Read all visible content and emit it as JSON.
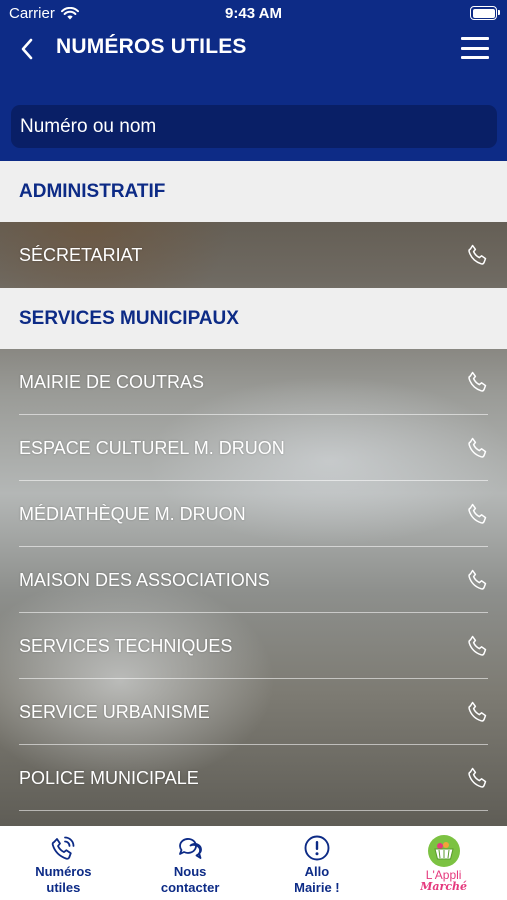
{
  "status_bar": {
    "carrier": "Carrier",
    "time": "9:43 AM"
  },
  "navbar": {
    "title": "NUMÉROS UTILES"
  },
  "search": {
    "placeholder": "Numéro ou nom"
  },
  "sections": [
    {
      "title": "ADMINISTRATIF",
      "items": [
        "SÉCRETARIAT"
      ]
    },
    {
      "title": "SERVICES MUNICIPAUX",
      "items": [
        "MAIRIE DE COUTRAS",
        "ESPACE CULTUREL M. DRUON",
        "MÉDIATHÈQUE M. DRUON",
        "MAISON DES ASSOCIATIONS",
        "SERVICES TECHNIQUES",
        "SERVICE URBANISME",
        "POLICE MUNICIPALE"
      ]
    }
  ],
  "tabbar": {
    "numeros": {
      "line1": "Numéros",
      "line2": "utiles"
    },
    "contact": {
      "line1": "Nous",
      "line2": "contacter"
    },
    "allo": {
      "line1": "Allo",
      "line2": "Mairie !"
    },
    "appli": {
      "line1": "L'Appli",
      "line2": "Marché"
    }
  },
  "colors": {
    "brand_blue": "#0d2b86",
    "search_bg": "#091f66",
    "section_bg": "#efefef",
    "logo_green": "#7cc242",
    "logo_pink": "#e5397d"
  },
  "icons": [
    "wifi-icon",
    "battery-icon",
    "back-chevron-icon",
    "hamburger-menu-icon",
    "phone-icon",
    "phone-waves-icon",
    "chat-bubbles-icon",
    "exclamation-circle-icon",
    "basket-logo-icon"
  ]
}
